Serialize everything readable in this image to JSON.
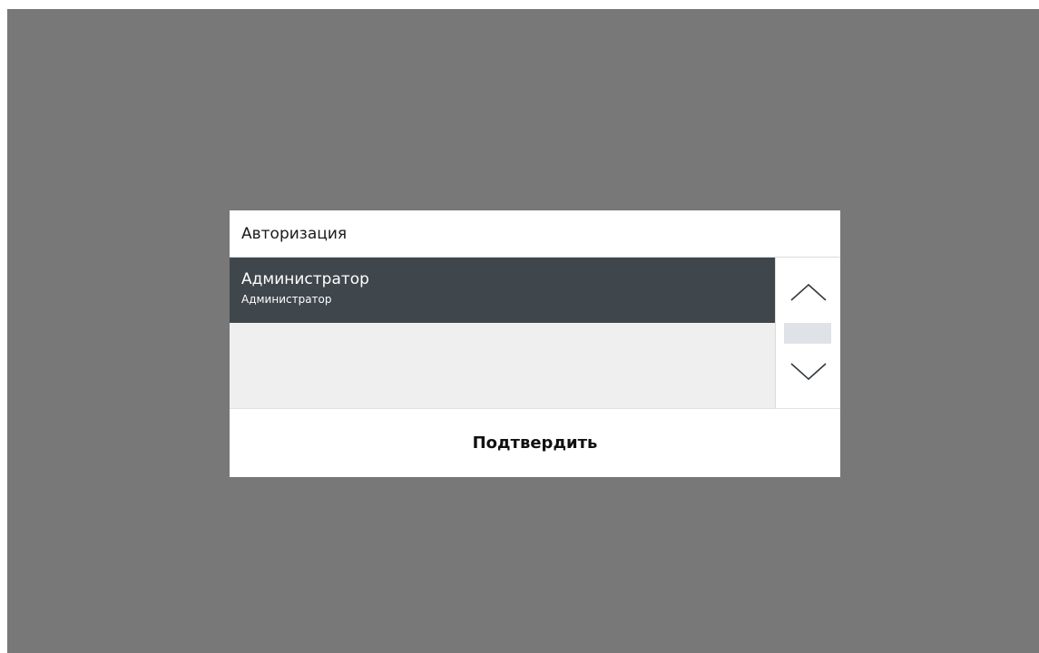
{
  "dialog": {
    "title": "Авторизация",
    "users": [
      {
        "name": "Администратор",
        "role": "Администратор",
        "selected": true
      }
    ],
    "scroll": {
      "up_icon": "chevron-up-icon",
      "down_icon": "chevron-down-icon"
    },
    "confirm_label": "Подтвердить"
  },
  "colors": {
    "overlay": "#787878",
    "selected_row": "#3f464c",
    "list_background": "#efefef",
    "scroll_thumb": "#dfe2e7"
  }
}
